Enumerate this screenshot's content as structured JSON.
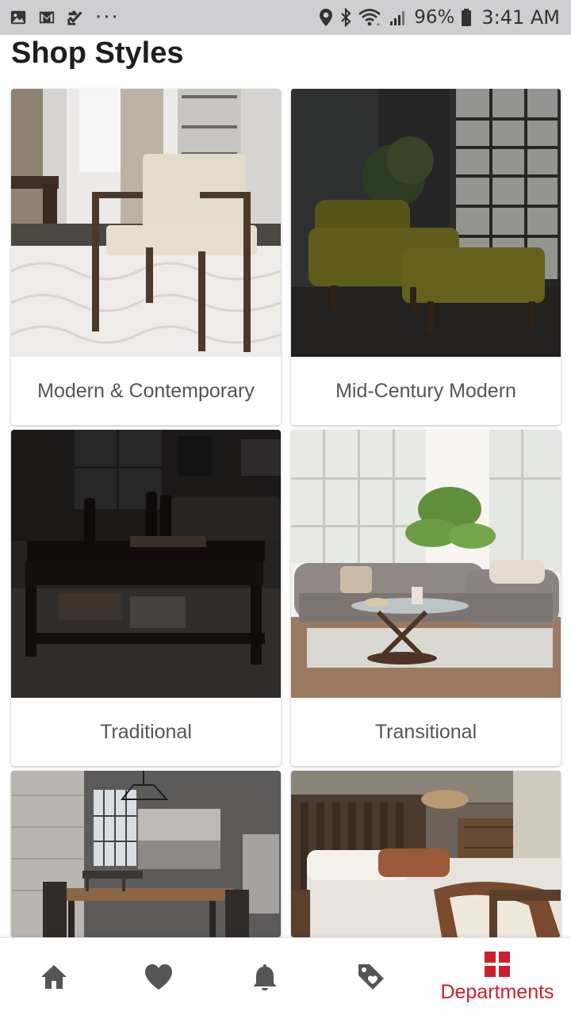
{
  "status_bar": {
    "battery": "96%",
    "time": "3:41 AM",
    "left_icons": [
      "image-icon",
      "gmail-icon",
      "check-icon",
      "more-dots-icon"
    ],
    "right_icons": [
      "location-icon",
      "bluetooth-icon",
      "wifi-icon",
      "signal-icon",
      "battery-icon"
    ]
  },
  "page": {
    "title": "Shop Styles"
  },
  "styles": [
    {
      "label": "Modern & Contemporary",
      "icon": "modern-chair-photo"
    },
    {
      "label": "Mid-Century Modern",
      "icon": "mid-century-armchair-photo"
    },
    {
      "label": "Traditional",
      "icon": "traditional-coffee-table-photo"
    },
    {
      "label": "Transitional",
      "icon": "transitional-sofa-photo"
    },
    {
      "label": "",
      "icon": "industrial-dining-photo"
    },
    {
      "label": "",
      "icon": "rustic-bedroom-photo"
    }
  ],
  "bottom_nav": {
    "items": [
      {
        "icon": "home-icon",
        "label": ""
      },
      {
        "icon": "heart-icon",
        "label": ""
      },
      {
        "icon": "bell-icon",
        "label": ""
      },
      {
        "icon": "tag-icon",
        "label": ""
      },
      {
        "icon": "departments-icon",
        "label": "Departments"
      }
    ],
    "active_color": "#cc1f2d",
    "inactive_color": "#555555"
  }
}
